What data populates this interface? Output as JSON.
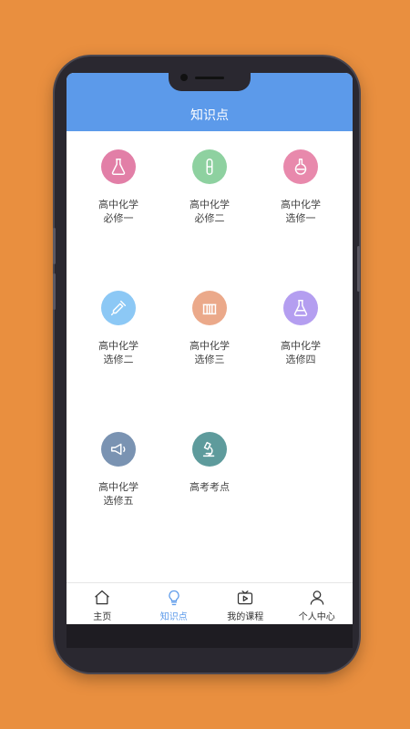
{
  "header": {
    "title": "知识点"
  },
  "grid": {
    "items": [
      {
        "label": "高中化学\n必修一",
        "icon": "flask-icon",
        "color": "#E27FA7"
      },
      {
        "label": "高中化学\n必修二",
        "icon": "test-tube-icon",
        "color": "#8ED1A0"
      },
      {
        "label": "高中化学\n选修一",
        "icon": "round-flask-icon",
        "color": "#E889AC"
      },
      {
        "label": "高中化学\n选修二",
        "icon": "dropper-icon",
        "color": "#8CC8F5"
      },
      {
        "label": "高中化学\n选修三",
        "icon": "rack-icon",
        "color": "#EBA98A"
      },
      {
        "label": "高中化学\n选修四",
        "icon": "beaker-icon",
        "color": "#B49EF0"
      },
      {
        "label": "高中化学\n选修五",
        "icon": "megaphone-icon",
        "color": "#7A93B2"
      },
      {
        "label": "高考考点",
        "icon": "microscope-icon",
        "color": "#5E9B9C"
      }
    ]
  },
  "tabbar": {
    "tabs": [
      {
        "label": "主页",
        "icon": "home-icon"
      },
      {
        "label": "知识点",
        "icon": "lightbulb-icon"
      },
      {
        "label": "我的课程",
        "icon": "tv-icon"
      },
      {
        "label": "个人中心",
        "icon": "person-icon"
      }
    ],
    "active_index": 1,
    "active_color": "#5C9AEA"
  },
  "colors": {
    "header": "#5C9AEA",
    "background": "#E98F3F"
  }
}
